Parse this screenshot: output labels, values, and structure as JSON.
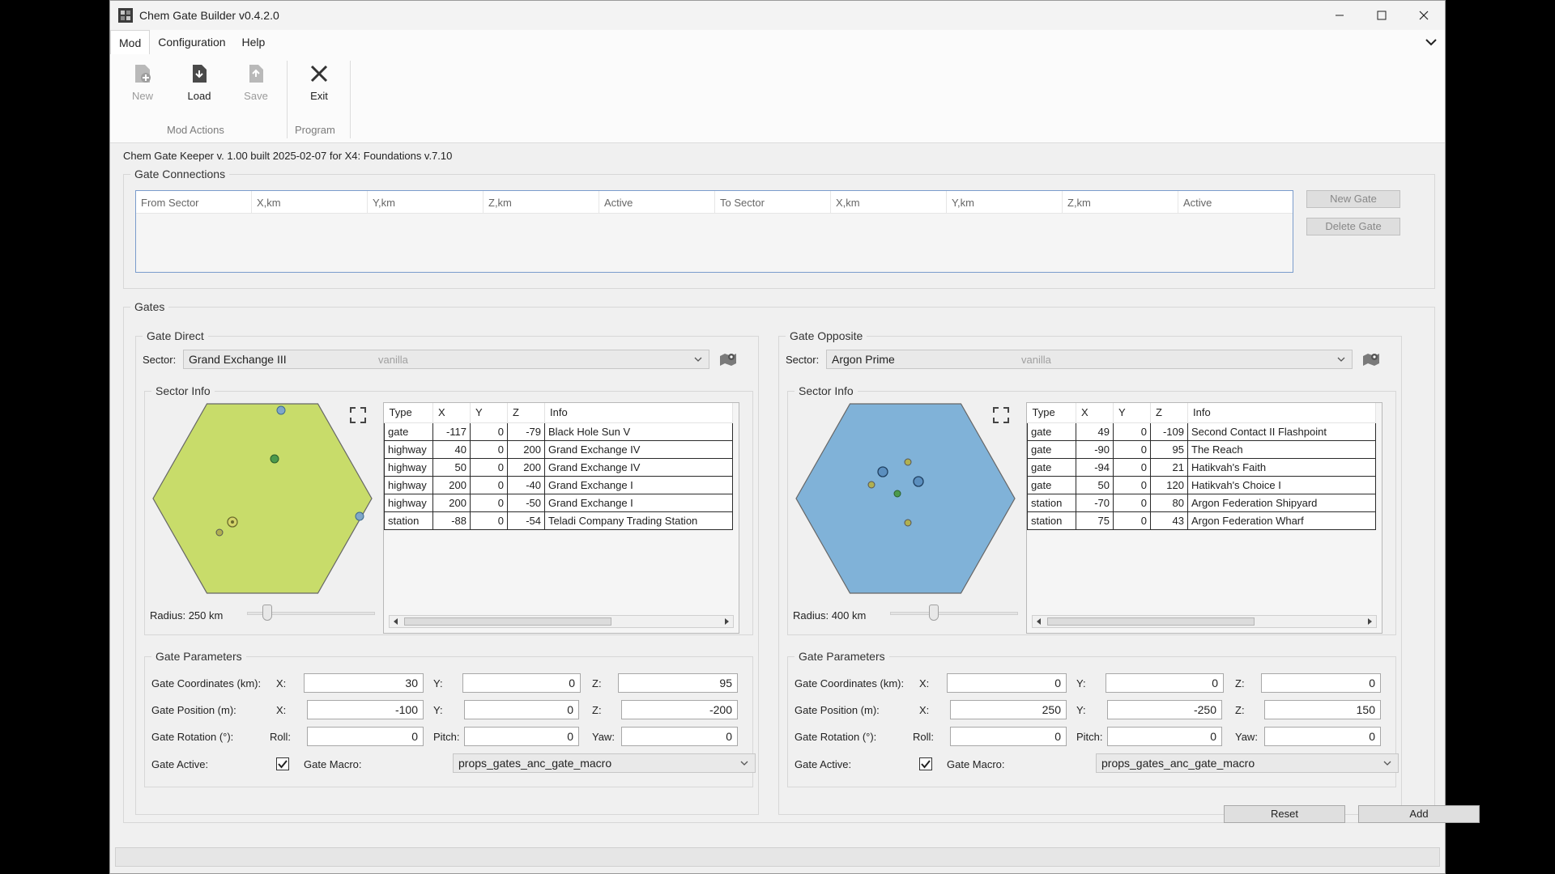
{
  "window": {
    "title": "Chem Gate Builder v0.4.2.0"
  },
  "menu": {
    "items": [
      "Mod",
      "Configuration",
      "Help"
    ]
  },
  "ribbon": {
    "new_label": "New",
    "load_label": "Load",
    "save_label": "Save",
    "exit_label": "Exit",
    "group_mod_actions": "Mod Actions",
    "group_program": "Program"
  },
  "version_line": "Chem Gate Keeper v. 1.00 built 2025-02-07 for X4: Foundations v.7.10",
  "gate_connections": {
    "legend": "Gate Connections",
    "columns": [
      "From Sector",
      "X,km",
      "Y,km",
      "Z,km",
      "Active",
      "To Sector",
      "X,km",
      "Y,km",
      "Z,km",
      "Active"
    ],
    "new_gate": "New Gate",
    "delete_gate": "Delete Gate"
  },
  "gates": {
    "legend": "Gates",
    "direct": {
      "legend": "Gate Direct",
      "sector_label": "Sector:",
      "sector": "Grand Exchange III",
      "sector_source": "vanilla",
      "sector_info_legend": "Sector Info",
      "hex_color": "#c8dc6a",
      "radius_label": "Radius: 250 km",
      "radius_slider_fraction": 0.13,
      "columns": [
        "Type",
        "X",
        "Y",
        "Z",
        "Info"
      ],
      "rows": [
        [
          "gate",
          "-117",
          "0",
          "-79",
          "Black Hole Sun V"
        ],
        [
          "highway",
          "40",
          "0",
          "200",
          "Grand Exchange IV"
        ],
        [
          "highway",
          "50",
          "0",
          "200",
          "Grand Exchange IV"
        ],
        [
          "highway",
          "200",
          "0",
          "-40",
          "Grand Exchange I"
        ],
        [
          "highway",
          "200",
          "0",
          "-50",
          "Grand Exchange I"
        ],
        [
          "station",
          "-88",
          "0",
          "-54",
          "Teladi Company Trading Station"
        ]
      ],
      "params": {
        "legend": "Gate Parameters",
        "coords_label": "Gate Coordinates (km):",
        "position_label": "Gate Position (m):",
        "rotation_label": "Gate Rotation (°):",
        "active_label": "Gate Active:",
        "macro_label": "Gate Macro:",
        "x_label": "X:",
        "y_label": "Y:",
        "z_label": "Z:",
        "roll_label": "Roll:",
        "pitch_label": "Pitch:",
        "yaw_label": "Yaw:",
        "coord_x": "30",
        "coord_y": "0",
        "coord_z": "95",
        "pos_x": "-100",
        "pos_y": "0",
        "pos_z": "-200",
        "roll": "0",
        "pitch": "0",
        "yaw": "0",
        "active": true,
        "macro": "props_gates_anc_gate_macro"
      }
    },
    "opposite": {
      "legend": "Gate Opposite",
      "sector_label": "Sector:",
      "sector": "Argon Prime",
      "sector_source": "vanilla",
      "sector_info_legend": "Sector Info",
      "hex_color": "#80b2d8",
      "radius_label": "Radius: 400 km",
      "radius_slider_fraction": 0.33,
      "columns": [
        "Type",
        "X",
        "Y",
        "Z",
        "Info"
      ],
      "rows": [
        [
          "gate",
          "49",
          "0",
          "-109",
          "Second Contact II Flashpoint"
        ],
        [
          "gate",
          "-90",
          "0",
          "95",
          "The Reach"
        ],
        [
          "gate",
          "-94",
          "0",
          "21",
          "Hatikvah's Faith"
        ],
        [
          "gate",
          "50",
          "0",
          "120",
          "Hatikvah's Choice I"
        ],
        [
          "station",
          "-70",
          "0",
          "80",
          "Argon Federation Shipyard"
        ],
        [
          "station",
          "75",
          "0",
          "43",
          "Argon Federation Wharf"
        ]
      ],
      "params": {
        "legend": "Gate Parameters",
        "coords_label": "Gate Coordinates (km):",
        "position_label": "Gate Position (m):",
        "rotation_label": "Gate Rotation (°):",
        "active_label": "Gate Active:",
        "macro_label": "Gate Macro:",
        "x_label": "X:",
        "y_label": "Y:",
        "z_label": "Z:",
        "roll_label": "Roll:",
        "pitch_label": "Pitch:",
        "yaw_label": "Yaw:",
        "coord_x": "0",
        "coord_y": "0",
        "coord_z": "0",
        "pos_x": "250",
        "pos_y": "-250",
        "pos_z": "150",
        "roll": "0",
        "pitch": "0",
        "yaw": "0",
        "active": true,
        "macro": "props_gates_anc_gate_macro"
      }
    }
  },
  "footer": {
    "reset": "Reset",
    "add": "Add"
  }
}
